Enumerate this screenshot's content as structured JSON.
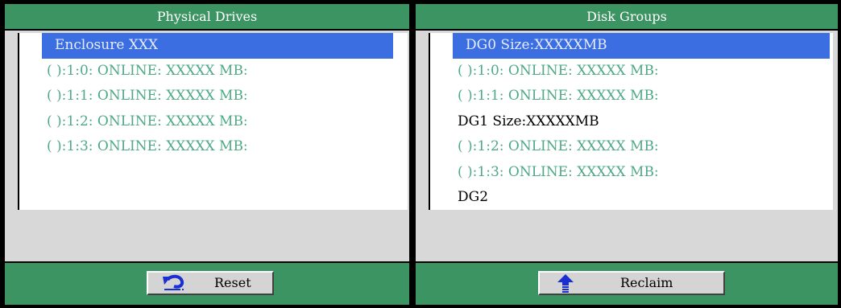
{
  "left_panel": {
    "title": "Physical Drives",
    "items": [
      {
        "text": "Enclosure XXX"
      },
      {
        "text": "( ):1:0: ONLINE: XXXXX MB:"
      },
      {
        "text": "( ):1:1: ONLINE: XXXXX MB:"
      },
      {
        "text": "( ):1:2: ONLINE: XXXXX MB:"
      },
      {
        "text": "( ):1:3: ONLINE: XXXXX MB:"
      }
    ],
    "button": {
      "label": "Reset",
      "icon": "undo-icon"
    }
  },
  "right_panel": {
    "title": "Disk Groups",
    "items": [
      {
        "text": "DG0 Size:XXXXXMB"
      },
      {
        "text": "( ):1:0: ONLINE: XXXXX MB:"
      },
      {
        "text": "( ):1:1: ONLINE: XXXXX MB:"
      },
      {
        "text": "DG1 Size:XXXXXMB"
      },
      {
        "text": "( ):1:2: ONLINE: XXXXX MB:"
      },
      {
        "text": "( ):1:3: ONLINE: XXXXX MB:"
      },
      {
        "text": "DG2"
      }
    ],
    "button": {
      "label": "Reclaim",
      "icon": "up-arrow-icon"
    }
  },
  "colors": {
    "header_bg": "#3b9462",
    "selection_bg": "#3b6ee0",
    "drive_text": "#4ea987",
    "pane_bg": "#d8d8d8"
  }
}
